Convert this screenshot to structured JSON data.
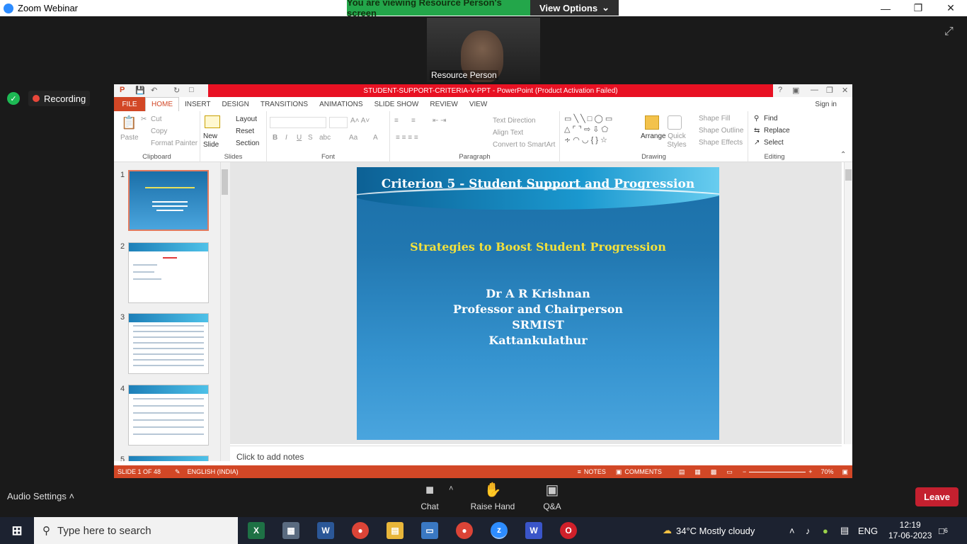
{
  "zoom": {
    "window_title": "Zoom Webinar",
    "banner_text": "You are viewing Resource Person's screen",
    "view_options": "View Options",
    "video_name": "Resource Person",
    "recording": "Recording",
    "audio_settings": "Audio Settings",
    "toolbar": [
      {
        "label": "Chat",
        "icon": "chat-icon"
      },
      {
        "label": "Raise Hand",
        "icon": "hand-icon"
      },
      {
        "label": "Q&A",
        "icon": "qa-icon"
      }
    ],
    "leave": "Leave"
  },
  "ppt": {
    "title": "STUDENT-SUPPORT-CRITERIA-V-PPT -  PowerPoint (Product Activation Failed)",
    "sign_in": "Sign in",
    "tabs": [
      "FILE",
      "HOME",
      "INSERT",
      "DESIGN",
      "TRANSITIONS",
      "ANIMATIONS",
      "SLIDE SHOW",
      "REVIEW",
      "VIEW"
    ],
    "ribbon": {
      "paste": "Paste",
      "cut": "Cut",
      "copy": "Copy",
      "format_painter": "Format Painter",
      "clipboard": "Clipboard",
      "new_slide": "New Slide",
      "layout": "Layout",
      "reset": "Reset",
      "section": "Section",
      "slides": "Slides",
      "font": "Font",
      "text_direction": "Text Direction",
      "align_text": "Align Text",
      "convert_smartart": "Convert to SmartArt",
      "paragraph": "Paragraph",
      "arrange": "Arrange",
      "quick_styles": "Quick Styles",
      "shape_fill": "Shape Fill",
      "shape_outline": "Shape Outline",
      "shape_effects": "Shape Effects",
      "drawing": "Drawing",
      "find": "Find",
      "replace": "Replace",
      "select": "Select",
      "editing": "Editing"
    },
    "thumbnails": [
      "1",
      "2",
      "3",
      "4",
      "5"
    ],
    "slide": {
      "title": "Criterion 5 - Student Support and Progression",
      "subtitle": "Strategies to Boost Student Progression",
      "name": "Dr A R Krishnan",
      "role": "Professor and Chairperson",
      "org": "SRMIST",
      "place": "Kattankulathur"
    },
    "notes_placeholder": "Click to add notes",
    "status": {
      "slide_count": "SLIDE 1 OF 48",
      "language": "ENGLISH (INDIA)",
      "notes": "NOTES",
      "comments": "COMMENTS",
      "zoom": "70%"
    }
  },
  "taskbar": {
    "search_placeholder": "Type here to search",
    "weather": "34°C  Mostly cloudy",
    "lang": "ENG",
    "time": "12:19",
    "date": "17-06-2023",
    "notifications": "6"
  }
}
